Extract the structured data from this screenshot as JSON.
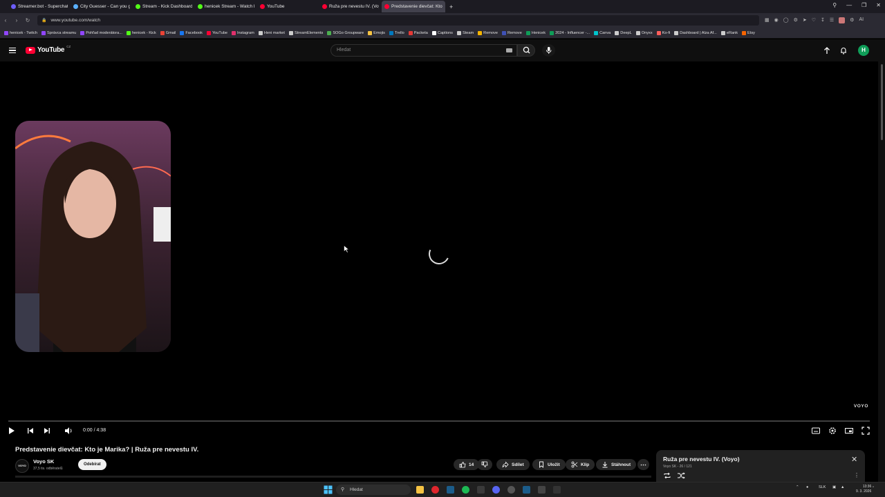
{
  "browser": {
    "tabs": [
      {
        "label": "Streamer.bot - Superchat",
        "color": "#6d5dfc",
        "active": false
      },
      {
        "label": "City Guesser - Can you g",
        "color": "#5ab0ff",
        "active": false
      },
      {
        "label": "Stream - Kick Dashboard",
        "color": "#53fc18",
        "active": false
      },
      {
        "label": "henicek Stream - Watch l",
        "color": "#53fc18",
        "active": false
      },
      {
        "label": "YouTube",
        "color": "#ff0033",
        "active": false
      },
      {
        "label": "Ruža pre nevestu IV. (Voyo)",
        "color": "#ff0033",
        "active": false
      },
      {
        "label": "Predstavenie dievčat: Kto",
        "color": "#ff0033",
        "active": true
      }
    ],
    "url": "www.youtube.com/watch",
    "bookmarks": [
      {
        "label": "henicek - Twitch",
        "color": "#9146ff"
      },
      {
        "label": "Správca streamu",
        "color": "#9146ff"
      },
      {
        "label": "Pohľad moderátora...",
        "color": "#9146ff"
      },
      {
        "label": "henicek - Kick",
        "color": "#53fc18"
      },
      {
        "label": "Gmail",
        "color": "#ea4335"
      },
      {
        "label": "Facebook",
        "color": "#1877f2"
      },
      {
        "label": "YouTube",
        "color": "#ff0033"
      },
      {
        "label": "Instagram",
        "color": "#e1306c"
      },
      {
        "label": "Heni market",
        "color": "#cccccc"
      },
      {
        "label": "StreamElements",
        "color": "#cccccc"
      },
      {
        "label": "SOGo Groupware",
        "color": "#4caf50"
      },
      {
        "label": "Emojis",
        "color": "#f6c343"
      },
      {
        "label": "Trello",
        "color": "#0079bf"
      },
      {
        "label": "Packeta",
        "color": "#e53935"
      },
      {
        "label": "Captions",
        "color": "#ffffff"
      },
      {
        "label": "Steam",
        "color": "#cccccc"
      },
      {
        "label": "Remove",
        "color": "#f5b400"
      },
      {
        "label": "Remove",
        "color": "#3f51b5"
      },
      {
        "label": "Henicek",
        "color": "#0f9d58"
      },
      {
        "label": "2024 - Influencer -...",
        "color": "#0f9d58"
      },
      {
        "label": "Canva",
        "color": "#00c4cc"
      },
      {
        "label": "DeepL",
        "color": "#cccccc"
      },
      {
        "label": "Onyxx",
        "color": "#cccccc"
      },
      {
        "label": "Ko-fi",
        "color": "#ff5e5b"
      },
      {
        "label": "Dashboard | Alza Af...",
        "color": "#cccccc"
      },
      {
        "label": "eRank",
        "color": "#cccccc"
      },
      {
        "label": "Etsy",
        "color": "#f56400"
      }
    ]
  },
  "youtube": {
    "logo_text": "YouTube",
    "region": "CZ",
    "search_placeholder": "Hledat",
    "avatar_letter": "H"
  },
  "player": {
    "time": "0:00 / 4:38",
    "progress": 0,
    "watermark": "VOYO",
    "state": "loading"
  },
  "video": {
    "title": "Predstavenie dievčat: Kto je Marika? | Ruža pre nevestu IV.",
    "channel": "Voyo SK",
    "channel_avatar_text": "VOYO",
    "subscribers": "37,5 tis. odběratelů",
    "subscribe_label": "Odebírat",
    "likes": "14",
    "share_label": "Sdílet",
    "save_label": "Uložit",
    "clip_label": "Klip",
    "download_label": "Stáhnout"
  },
  "playlist": {
    "title": "Ruža pre nevestu IV. (Voyo)",
    "meta": "Voyo SK - 26 / 121"
  },
  "taskbar": {
    "search_placeholder": "Hledat",
    "lang": "SLK",
    "time": "13:36",
    "date": "9. 3. 2026"
  }
}
